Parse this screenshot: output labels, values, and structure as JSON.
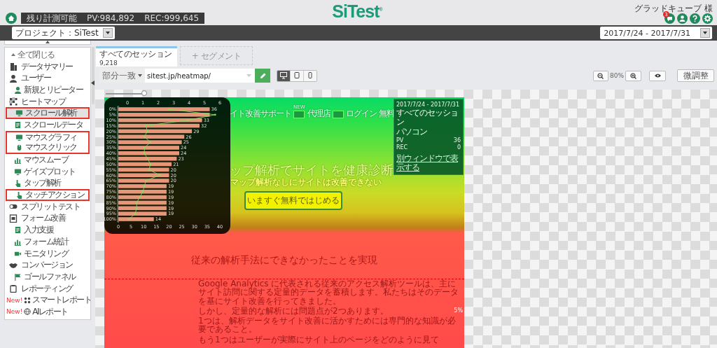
{
  "quota": {
    "label": "残り計測可能",
    "pv": "PV:984,892",
    "rec": "REC:999,645"
  },
  "logo": {
    "text": "SiTest",
    "mark": "®"
  },
  "user": {
    "name": "グラッドキューブ 様",
    "notification_count": "3"
  },
  "toolbar": {
    "project": "プロジェクト：SiTest",
    "date_range": "2017/7/24 - 2017/7/31"
  },
  "sidebar": {
    "collapse_all": "全て閉じる",
    "items": [
      {
        "label": "データサマリー",
        "selected": false,
        "highlighted": false
      },
      {
        "label": "ユーザー",
        "selected": false,
        "highlighted": false,
        "children": [
          {
            "label": "新規とリピーター",
            "selected": false,
            "highlighted": false
          }
        ]
      },
      {
        "label": "ヒートマップ",
        "selected": false,
        "highlighted": false,
        "children": [
          {
            "label": "スクロール解析",
            "selected": true,
            "highlighted": true
          },
          {
            "label": "スクロールデータ",
            "selected": false,
            "highlighted": false
          },
          {
            "label": "マウスグラフィ",
            "selected": false,
            "highlighted": true
          },
          {
            "label": "マウスクリック",
            "selected": false,
            "highlighted": true
          },
          {
            "label": "マウスムーブ",
            "selected": false,
            "highlighted": false
          },
          {
            "label": "ゲイズプロット",
            "selected": false,
            "highlighted": false
          },
          {
            "label": "タップ解析",
            "selected": false,
            "highlighted": false
          },
          {
            "label": "タッチアクション",
            "selected": false,
            "highlighted": true
          }
        ]
      },
      {
        "label": "スプリットテスト",
        "selected": false,
        "highlighted": false
      },
      {
        "label": "フォーム改善",
        "selected": false,
        "highlighted": false,
        "children": [
          {
            "label": "入力支援",
            "selected": false,
            "highlighted": false
          },
          {
            "label": "フォーム統計",
            "selected": false,
            "highlighted": false
          },
          {
            "label": "モニタリング",
            "selected": false,
            "highlighted": false
          }
        ]
      },
      {
        "label": "コンバージョン",
        "selected": false,
        "highlighted": false,
        "children": [
          {
            "label": "ゴールファネル",
            "selected": false,
            "highlighted": false
          }
        ]
      },
      {
        "label": "レポーティング",
        "selected": false,
        "highlighted": false
      },
      {
        "label": "スマートレポート",
        "badge": "New!",
        "selected": false,
        "highlighted": false
      },
      {
        "label": "AIレポート",
        "badge": "New!",
        "selected": false,
        "highlighted": false
      }
    ]
  },
  "segments": [
    {
      "kind": "session",
      "label": "すべてのセッション",
      "count": "9,218",
      "selected": true
    },
    {
      "kind": "add",
      "label": "+ セグメント",
      "selected": false
    }
  ],
  "filter": {
    "match": "部分一致",
    "url": "sitest.jp/heatmap/"
  },
  "devices": [
    {
      "kind": "desktop",
      "selected": true
    },
    {
      "kind": "tablet",
      "selected": false
    },
    {
      "kind": "phone",
      "selected": false
    }
  ],
  "zoom": {
    "value": "80%"
  },
  "adjust_button": "微調整",
  "opacity_slider": {
    "level": 1
  },
  "scroll_chart": {
    "bars": {
      "chart_data": {
        "type": "bar",
        "orientation": "horizontal",
        "categories": [
          "0%",
          "5%",
          "10%",
          "15%",
          "20%",
          "25%",
          "30%",
          "35%",
          "40%",
          "45%",
          "50%",
          "55%",
          "60%",
          "65%",
          "70%",
          "75%",
          "80%",
          "85%",
          "90%",
          "95%",
          "100%"
        ],
        "series": [
          {
            "color": "#e8967a",
            "values": [
              36,
              36,
              33,
              32,
              29,
              26,
              25,
              24,
              24,
              23,
              21,
              20,
              20,
              20,
              19,
              19,
              19,
              19,
              19,
              19,
              14
            ]
          }
        ],
        "xlim": [
          0,
          40
        ],
        "xticks": [
          0,
          5,
          10,
          15,
          20,
          25,
          30,
          35,
          40
        ],
        "value_labels": [
          "36",
          null,
          "33",
          "32",
          "29",
          "26",
          "25",
          "24",
          "24",
          "23",
          "21",
          "20",
          "20",
          "20",
          "19",
          "19",
          "19",
          "19",
          "19",
          "19",
          "14"
        ]
      }
    },
    "trend": {
      "chart_data": {
        "type": "line",
        "orientation": "horizontal",
        "series": [
          {
            "color": "#86e05a",
            "values": [
              2.7,
              5.7,
              3.9,
              1.2,
              1.3,
              1.1,
              1.5,
              1.1,
              1.1,
              1.3,
              1.5,
              1.4,
              2.1,
              1.2,
              1.1,
              1.0,
              0.8,
              0.6,
              0.6,
              0.5,
              0.1
            ]
          }
        ],
        "xlim": [
          0,
          6
        ],
        "xticks": [
          0,
          1,
          2,
          3,
          4,
          5,
          6
        ]
      }
    }
  },
  "info_panel": {
    "date_range": "2017/7/24 - 2017/7/31",
    "segment": "すべてのセッション",
    "device": "パソコン",
    "stats": [
      {
        "label": "PV",
        "value": "36"
      },
      {
        "label": "REC",
        "value": "0"
      }
    ],
    "link": "別ウィンドウで表示する"
  },
  "page_preview": {
    "nav": [
      {
        "kind": "text",
        "label": "イト改善サポート"
      },
      {
        "kind": "box",
        "badge": "NEW"
      },
      {
        "kind": "text",
        "label": "代理店"
      },
      {
        "kind": "box"
      },
      {
        "kind": "text",
        "label": "ログイン"
      },
      {
        "kind": "text",
        "label": "無料"
      }
    ],
    "headline": "ップ解析でサイトを健康診断",
    "subheadline": "マップ解析なしにサイトは改善できない",
    "cta": "いますぐ無料ではじめる",
    "section_title": "従来の解析手法にできなかったことを実現",
    "paragraphs": [
      "Google Analytics に代表される従来のアクセス解析ツールは、主にサイト訪問に関する定量的データを蓄積します。私たちはそのデータを基にサイト改善を行ってきました。",
      "しかし、定量的な解析には問題点が2つあります。",
      "1つは、解析データをサイト改善に活かすためには専門的な知識が必要であること。",
      "もう1つはユーザーが実際にサイト上のページをどのように見て"
    ],
    "fold_marker": "5%"
  }
}
